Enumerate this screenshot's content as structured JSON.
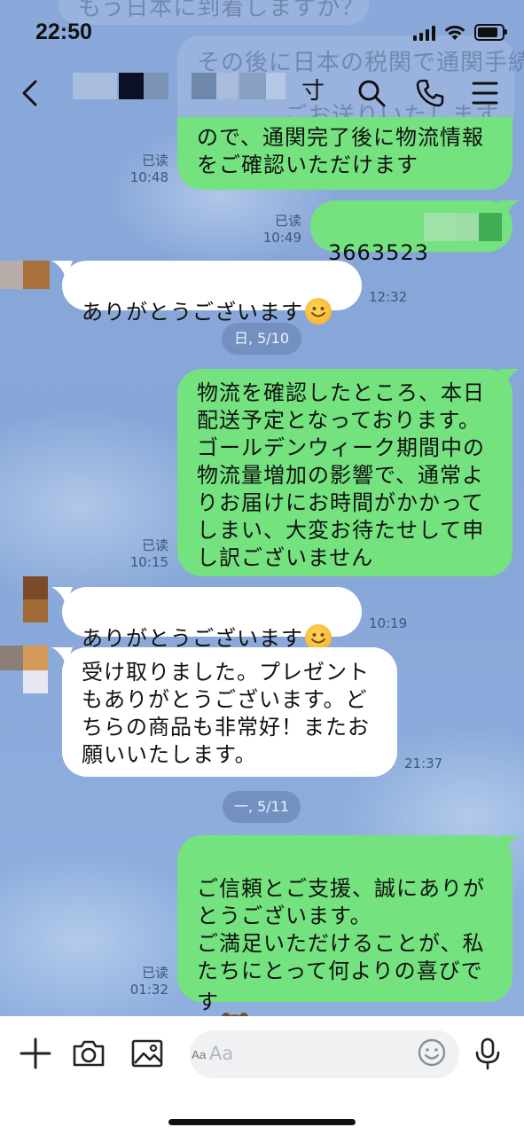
{
  "status_bar": {
    "time": "22:50"
  },
  "header": {
    "contact_name_partial": "寸"
  },
  "background_ghost": {
    "line1": "もう日本に到着しますか？",
    "line2": "その後に日本の税関で通関手続",
    "line3": "ごお送りいたします"
  },
  "messages": [
    {
      "id": "m1",
      "direction": "out",
      "text": "ので、通関完了後に物流情報\nをご確認いただけます",
      "read": "已读",
      "time": "10:48"
    },
    {
      "id": "m2",
      "direction": "out",
      "text": "3663523",
      "read": "已读",
      "time": "10:49"
    },
    {
      "id": "m3",
      "direction": "in",
      "text": "ありがとうございます",
      "emoji": "smile",
      "time": "12:32"
    },
    {
      "id": "m4",
      "direction": "out",
      "text": "物流を確認したところ、本日\n配送予定となっております。\nゴールデンウィーク期間中の\n物流量増加の影響で、通常よ\nりお届けにお時間がかかって\nしまい、大変お待たせして申\nし訳ございません",
      "read": "已读",
      "time": "10:15"
    },
    {
      "id": "m5",
      "direction": "in",
      "text": "ありがとうございます",
      "emoji": "smile",
      "time": "10:19"
    },
    {
      "id": "m6",
      "direction": "in",
      "text": "受け取りました。プレゼント\nもありがとうございます。ど\nちらの商品も非常好！またお\n願いいたします。",
      "time": "21:37"
    },
    {
      "id": "m7",
      "direction": "out",
      "text": "ご信頼とご支援、誠にありが\nとうございます。\nご満足いただけることが、私\nたちにとって何よりの喜びで\nす",
      "emoji": "bear",
      "read": "已读",
      "time": "01:32"
    }
  ],
  "date_separators": [
    {
      "id": "d1",
      "label": "日, 5/10"
    },
    {
      "id": "d2",
      "label": "一, 5/11"
    }
  ],
  "composer": {
    "placeholder": "Aa"
  },
  "icons": {
    "back": "chevron-left-icon",
    "search": "search-icon",
    "call": "phone-icon",
    "menu": "hamburger-menu-icon",
    "add": "plus-icon",
    "camera": "camera-icon",
    "image": "image-icon",
    "emoji": "emoji-icon",
    "mic": "microphone-icon"
  },
  "colors": {
    "outgoing_bubble": "#74e27f",
    "incoming_bubble": "#ffffff",
    "chat_background": "#88a7d9",
    "date_pill": "#7390c0"
  }
}
